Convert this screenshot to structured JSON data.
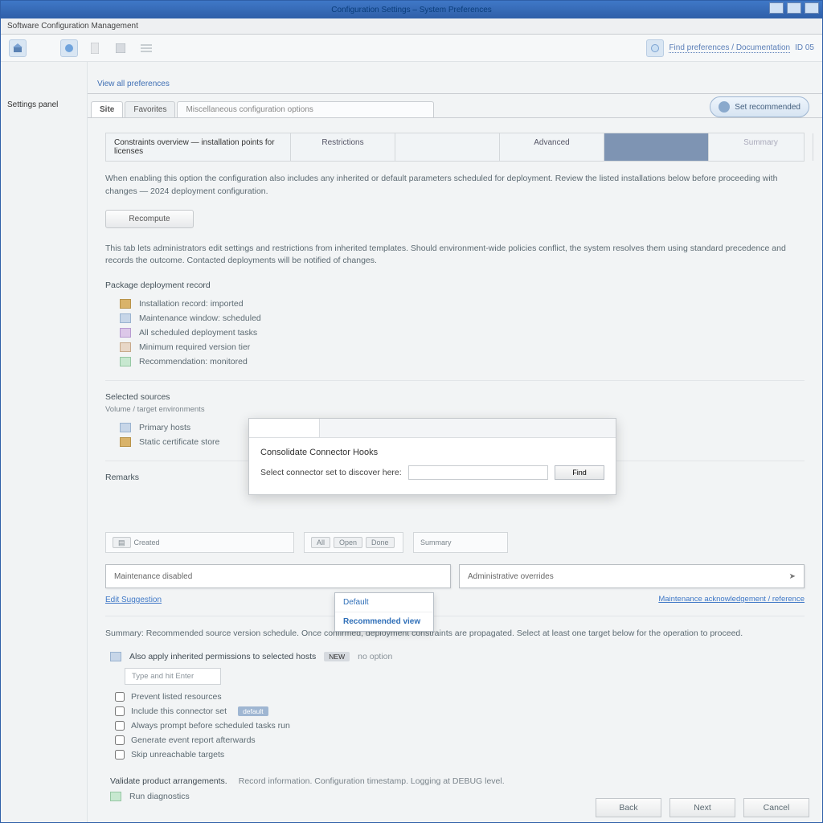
{
  "window": {
    "title": "Configuration Settings – System Preferences"
  },
  "menubar": {
    "label": "Software Configuration Management"
  },
  "toolbar": {
    "search_link": "Find preferences / Documentation",
    "search_id": "ID 05"
  },
  "sidebar": {
    "heading": "Settings panel"
  },
  "top_tabs": {
    "link_label": "View all preferences",
    "items": [
      "Site",
      "Favorites"
    ],
    "wide_placeholder": "Miscellaneous configuration options"
  },
  "pill_button": {
    "label": "Set recommended"
  },
  "tabstrip2": {
    "lead": "Constraints overview — installation points for licenses",
    "cells": [
      "Restrictions",
      "",
      "Advanced",
      "",
      "Summary"
    ]
  },
  "paragraphs": {
    "p1": "When enabling this option the configuration also includes any inherited or default parameters scheduled for deployment. Review the listed installations below before proceeding with changes — 2024 deployment configuration.",
    "p2": "This tab lets administrators edit settings and restrictions from inherited templates. Should environment-wide policies conflict, the system resolves them using standard precedence and records the outcome. Contacted deployments will be notified of changes."
  },
  "button_refresh": "Recompute",
  "section_a": {
    "title": "Package deployment record",
    "rows": [
      "Installation record: imported",
      "Maintenance window: scheduled",
      "All scheduled deployment tasks",
      "Minimum required version tier",
      "Recommendation: monitored"
    ]
  },
  "section_b": {
    "title": "Selected sources",
    "subtitle": "Volume / target environments",
    "rows": [
      "Primary hosts",
      "Static certificate store"
    ]
  },
  "dialog": {
    "title": "Consolidate Connector Hooks",
    "prompt": "Select connector set to discover here:",
    "find": "Find"
  },
  "remarks_label": "Remarks",
  "panels": {
    "p1": "Created",
    "p2_seg1": "All",
    "p2_seg2": "Open",
    "p2_seg3": "Done",
    "p3": "Summary"
  },
  "widebar": {
    "left": "Maintenance disabled",
    "right": "Administrative overrides"
  },
  "dropdown": {
    "item1": "Default",
    "item2": "Recommended view"
  },
  "link_below": "Edit Suggestion",
  "right_link": "Maintenance acknowledgement / reference",
  "lower_para": "Summary: Recommended source version schedule. Once confirmed, deployment constraints are propagated. Select at least one target below for the operation to proceed.",
  "lower_line": {
    "left": "Also apply inherited permissions to selected hosts",
    "tag": "NEW",
    "right": "no option"
  },
  "placeholder_box": "Type and hit Enter",
  "checks": [
    "Prevent listed resources",
    "Include this connector set",
    "Always prompt before scheduled tasks run",
    "Generate event report afterwards",
    "Skip unreachable targets"
  ],
  "check_chip": "default",
  "final_line": {
    "a": "Validate product arrangements.",
    "b": "Record information. Configuration timestamp. Logging at DEBUG level."
  },
  "final_sub": "Run diagnostics",
  "footer": {
    "back": "Back",
    "next": "Next",
    "cancel": "Cancel"
  }
}
